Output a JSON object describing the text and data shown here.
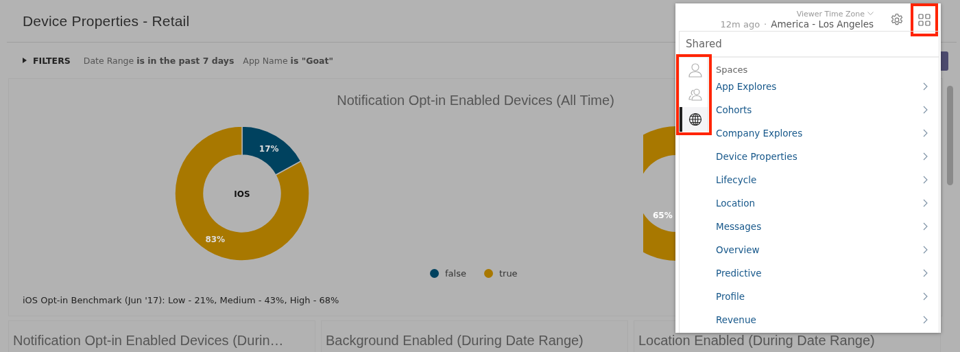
{
  "page": {
    "title": "Device Properties - Retail"
  },
  "filters": {
    "label": "FILTERS",
    "expanded": false,
    "items": [
      "Date Range **is in the past 7 days**",
      "App Name **is \"Goat\"**"
    ]
  },
  "main_chart": {
    "title": "Notification Opt-in Enabled Devices (All Time)",
    "chart_data": {
      "type": "donut",
      "categories": [
        "false",
        "true"
      ],
      "series": [
        {
          "name": "IOS",
          "values": [
            17,
            83
          ]
        }
      ],
      "value_labels": [
        "17%",
        "83%"
      ]
    },
    "legend": [
      {
        "color": "#00425f"
      },
      {
        "color": "#a87800"
      }
    ],
    "second_chart_label": "65%",
    "benchmark": "iOS Opt-in Benchmark (Jun '17): Low - 21%, Medium - 43%, High - 68%"
  },
  "cards": [
    "Notification Opt-in Enabled Devices (Durin…",
    "Background Enabled (During Date Range)",
    "Location Enabled (During Date Range)"
  ],
  "menu": {
    "viewer_time_zone": "Viewer Time Zone",
    "updated": "12m ago",
    "separator": "·",
    "time_zone": "America - Los Angeles",
    "grid_button_highlighted": true,
    "header": "Shared",
    "rail_highlighted": true,
    "rail": [
      {
        "kind": "person",
        "selected": false
      },
      {
        "kind": "people",
        "selected": false
      },
      {
        "kind": "globe",
        "selected": true
      }
    ],
    "section": "Spaces",
    "items": [
      "App Explores",
      "Cohorts",
      "Company Explores",
      "Device Properties",
      "Lifecycle",
      "Location",
      "Messages",
      "Overview",
      "Predictive",
      "Profile",
      "Revenue"
    ]
  }
}
